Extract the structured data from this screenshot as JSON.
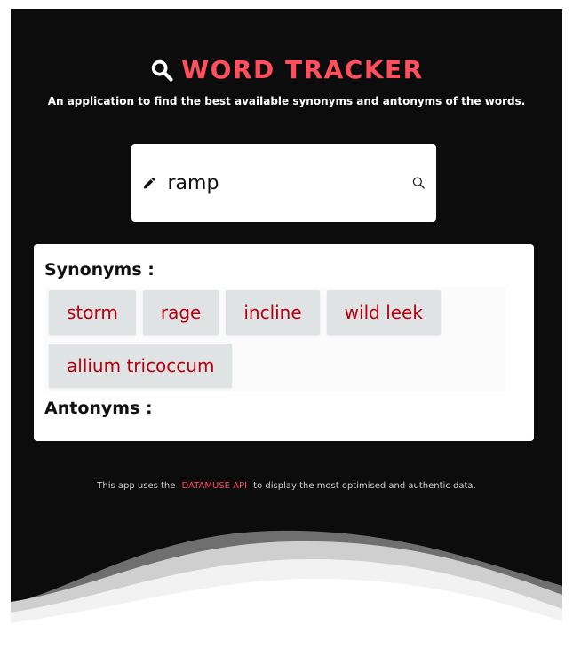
{
  "header": {
    "title": "WORD TRACKER",
    "subtitle": "An application to find the best available synonyms and antonyms of the words."
  },
  "search": {
    "value": "ramp"
  },
  "results": {
    "synonyms_label": "Synonyms :",
    "synonyms": [
      "storm",
      "rage",
      "incline",
      "wild leek",
      "allium tricoccum"
    ],
    "antonyms_label": "Antonyms :",
    "antonyms": []
  },
  "footer": {
    "prefix": "This app uses the",
    "api_link": "DATAMUSE API",
    "suffix": "to display the most optimised and authentic data."
  },
  "icons": {
    "title": "search-icon",
    "input_left": "pencil-icon",
    "input_right": "search-icon"
  },
  "colors": {
    "accent": "#ff4f5e",
    "chip_text": "#b5000f",
    "chip_bg": "#dfe3e3",
    "background": "#0c0c0c"
  }
}
